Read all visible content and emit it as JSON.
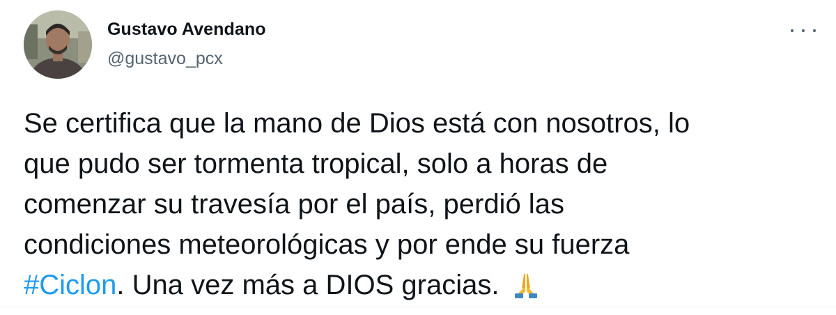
{
  "author": {
    "name": "Gustavo Avendano",
    "handle": "@gustavo_pcx"
  },
  "more_icon": "more-horizontal-icon",
  "tweet": {
    "lines": [
      "Se certifica que la mano de Dios está con nosotros, lo",
      "que pudo ser tormenta tropical, solo a horas de",
      "comenzar su travesía por el país, perdió las",
      "condiciones  meteorológicas y por ende su fuerza"
    ],
    "hashtag": "#Ciclon",
    "last_line_text": ". Una vez más a DIOS gracias.",
    "emoji": "praying-hands-emoji"
  },
  "colors": {
    "hashtag": "#1d9bf0",
    "handle": "#536471",
    "text": "#0f1419"
  }
}
